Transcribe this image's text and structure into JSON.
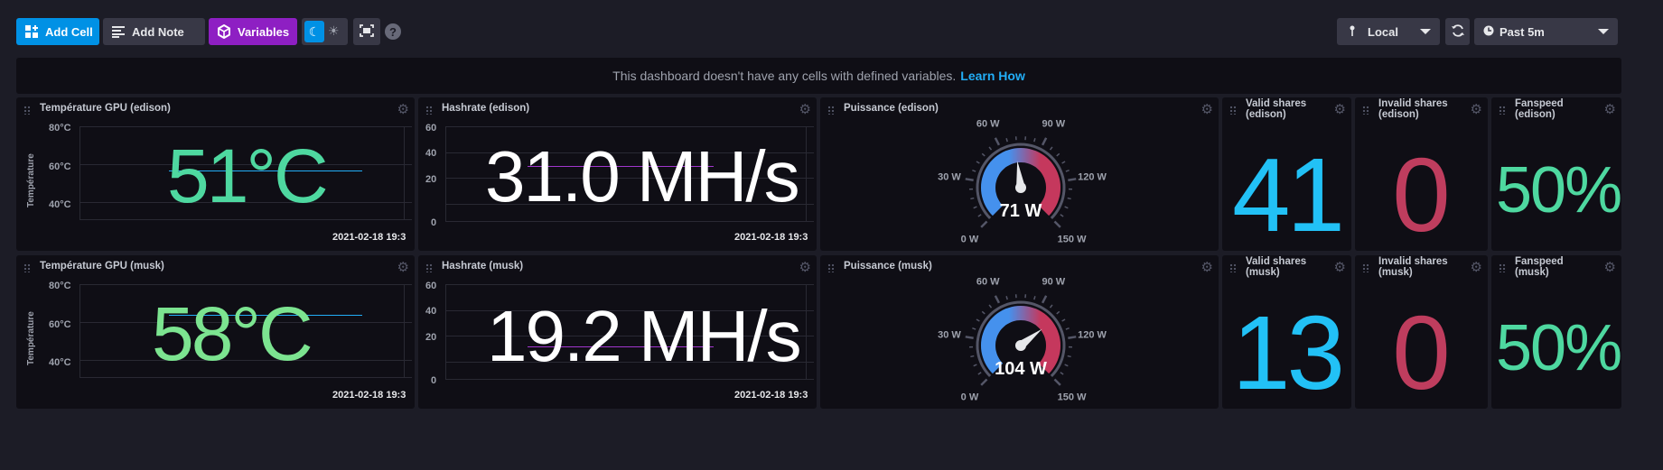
{
  "toolbar": {
    "add_cell": "Add Cell",
    "add_note": "Add Note",
    "variables": "Variables",
    "help": "?",
    "local": "Local",
    "time_range": "Past 5m"
  },
  "notice": {
    "text": "This dashboard doesn't have any cells with defined variables.",
    "link": "Learn How"
  },
  "colors": {
    "accent": "#0091e5",
    "variables": "#8e1fc3",
    "green": "#4ed8a0",
    "cyan": "#22adf6",
    "red": "#bf3d5e",
    "panel": "#0f0e15"
  },
  "cells": {
    "temp_edison": {
      "title": "Température GPU (edison)",
      "value": "51°C",
      "ticks": [
        "80°C",
        "60°C",
        "40°C"
      ],
      "ylabel": "Température",
      "timestamp": "2021-02-18 19:3"
    },
    "hash_edison": {
      "title": "Hashrate (edison)",
      "value": "31.0 MH/s",
      "ticks": [
        "60",
        "40",
        "20",
        "0"
      ],
      "timestamp": "2021-02-18 19:3"
    },
    "power_edison": {
      "title": "Puissance (edison)",
      "value": "71 W",
      "gauge_fraction": 0.473,
      "labels": [
        "0 W",
        "30 W",
        "60 W",
        "90 W",
        "120 W",
        "150 W"
      ]
    },
    "valid_edison": {
      "title_1": "Valid shares",
      "title_2": "(edison)",
      "value": "41"
    },
    "invalid_edison": {
      "title_1": "Invalid shares",
      "title_2": "(edison)",
      "value": "0"
    },
    "fan_edison": {
      "title_1": "Fanspeed",
      "title_2": "(edison)",
      "value": "50%"
    },
    "temp_musk": {
      "title": "Température GPU (musk)",
      "value": "58°C",
      "ticks": [
        "80°C",
        "60°C",
        "40°C"
      ],
      "ylabel": "Température",
      "timestamp": "2021-02-18 19:3"
    },
    "hash_musk": {
      "title": "Hashrate (musk)",
      "value": "19.2 MH/s",
      "ticks": [
        "60",
        "40",
        "20",
        "0"
      ],
      "timestamp": "2021-02-18 19:3"
    },
    "power_musk": {
      "title": "Puissance (musk)",
      "value": "104 W",
      "gauge_fraction": 0.693,
      "labels": [
        "0 W",
        "30 W",
        "60 W",
        "90 W",
        "120 W",
        "150 W"
      ]
    },
    "valid_musk": {
      "title_1": "Valid shares",
      "title_2": "(musk)",
      "value": "13"
    },
    "invalid_musk": {
      "title_1": "Invalid shares",
      "title_2": "(musk)",
      "value": "0"
    },
    "fan_musk": {
      "title_1": "Fanspeed",
      "title_2": "(musk)",
      "value": "50%"
    }
  }
}
